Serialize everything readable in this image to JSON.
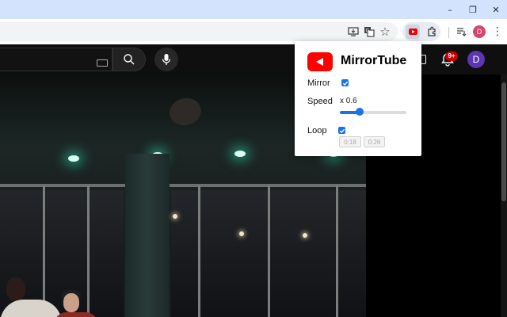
{
  "window": {
    "minimize_glyph": "–",
    "maximize_glyph": "❐",
    "close_glyph": "✕"
  },
  "toolbar": {
    "icons": [
      "install-app-icon",
      "translate-icon",
      "bookmark-star-icon",
      "mirrortube-extension-icon",
      "extensions-puzzle-icon",
      "reading-list-icon",
      "profile-avatar",
      "chrome-menu-icon"
    ],
    "profile_initial": "D",
    "star_glyph": "☆",
    "menu_glyph": "⋮"
  },
  "youtube": {
    "notification_count": "9+",
    "avatar_initial": "D"
  },
  "popup": {
    "title": "MirrorTube",
    "mirror_label": "Mirror",
    "mirror_checked": true,
    "speed_label": "Speed",
    "speed_value": "x 0.6",
    "speed_fraction": 0.3,
    "loop_label": "Loop",
    "loop_checked": true,
    "loop_start": "0:18",
    "loop_end": "0:26"
  },
  "colors": {
    "accent": "#1a73e8",
    "youtube_red": "#ff0000",
    "chrome_frame": "#d3e3fd",
    "youtube_header": "#0f0f0f"
  }
}
